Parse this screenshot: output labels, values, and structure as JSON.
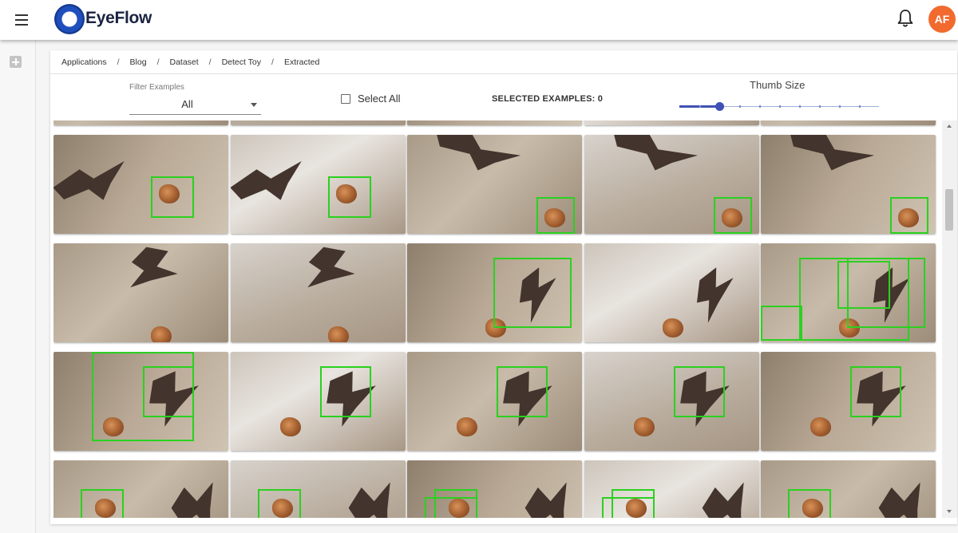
{
  "app": {
    "brand": "EyeFlow",
    "user_initials": "AF"
  },
  "breadcrumb": [
    "Applications",
    "Blog",
    "Dataset",
    "Detect Toy",
    "Extracted"
  ],
  "breadcrumb_separator": "/",
  "toolbar": {
    "filter_label": "Filter Examples",
    "filter_value": "All",
    "select_all_label": "Select All",
    "select_all_checked": false,
    "selected_examples_text": "SELECTED EXAMPLES: 0",
    "thumb_size_label": "Thumb Size",
    "thumb_size_step": 2,
    "thumb_size_steps": 10
  },
  "colors": {
    "accent": "#3f51b5",
    "brand_blue": "#1f4fbd",
    "avatar": "#f26a2e",
    "bounding_box": "#2ad11f"
  },
  "icons": [
    "menu-icon",
    "eyeflow-logo",
    "bell-icon",
    "add-icon",
    "dropdown-arrow-icon",
    "checkbox-icon"
  ],
  "grid": {
    "columns": 5,
    "items": [
      {
        "scene": "cut"
      },
      {
        "scene": "cut"
      },
      {
        "scene": "cut"
      },
      {
        "scene": "cut"
      },
      {
        "scene": "cut"
      },
      {
        "scene": "toy-center",
        "boxes": 1
      },
      {
        "scene": "toy-center",
        "boxes": 1
      },
      {
        "scene": "toy-right",
        "boxes": 1
      },
      {
        "scene": "toy-right",
        "boxes": 1
      },
      {
        "scene": "toy-right",
        "boxes": 1
      },
      {
        "scene": "bat-top",
        "boxes": 0
      },
      {
        "scene": "bat-top",
        "boxes": 0
      },
      {
        "scene": "bat-mid",
        "boxes": 1
      },
      {
        "scene": "bat-mid",
        "boxes": 0
      },
      {
        "scene": "bat-mid",
        "boxes": 4
      },
      {
        "scene": "bat-right",
        "boxes": 2
      },
      {
        "scene": "bat-right",
        "boxes": 1
      },
      {
        "scene": "bat-right",
        "boxes": 1
      },
      {
        "scene": "bat-right",
        "boxes": 1
      },
      {
        "scene": "bat-right",
        "boxes": 1
      },
      {
        "scene": "bat-low",
        "boxes": 1
      },
      {
        "scene": "bat-low",
        "boxes": 1
      },
      {
        "scene": "bat-low",
        "boxes": 2
      },
      {
        "scene": "bat-low",
        "boxes": 2
      },
      {
        "scene": "bat-low",
        "boxes": 1
      }
    ]
  }
}
